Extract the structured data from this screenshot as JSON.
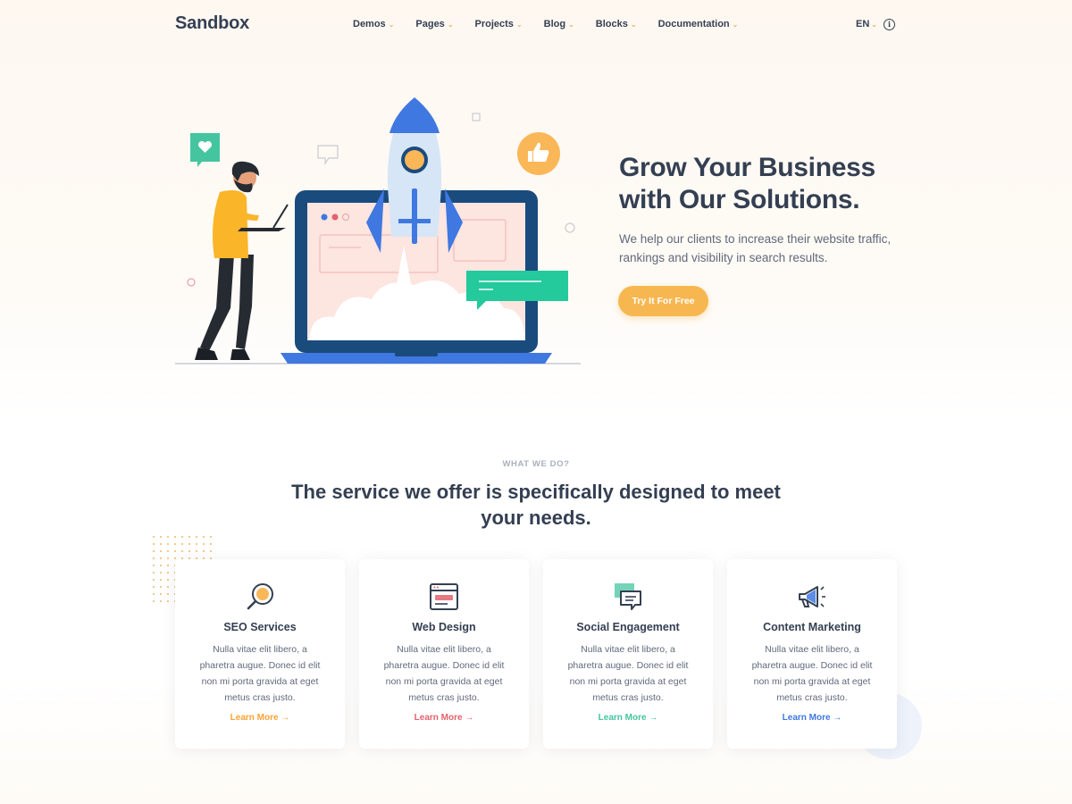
{
  "brand": {
    "logo_text": "Sandbox"
  },
  "nav": {
    "items": [
      {
        "label": "Demos"
      },
      {
        "label": "Pages"
      },
      {
        "label": "Projects"
      },
      {
        "label": "Blog"
      },
      {
        "label": "Blocks"
      },
      {
        "label": "Documentation"
      }
    ],
    "language": "EN"
  },
  "hero": {
    "title": "Grow Your Business with Our Solutions.",
    "text": "We help our clients to increase their website traffic, rankings and visibility in search results.",
    "button_label": "Try It For Free"
  },
  "services": {
    "kicker": "WHAT WE DO?",
    "title": "The service we offer is specifically designed to meet your needs.",
    "cards": [
      {
        "title": "SEO Services",
        "text": "Nulla vitae elit libero, a pharetra augue. Donec id elit non mi porta gravida at eget metus cras justo.",
        "link": "Learn More →",
        "accent": "#f7a336",
        "icon": "search-icon"
      },
      {
        "title": "Web Design",
        "text": "Nulla vitae elit libero, a pharetra augue. Donec id elit non mi porta gravida at eget metus cras justo.",
        "link": "Learn More →",
        "accent": "#e2626b",
        "icon": "browser-window-icon"
      },
      {
        "title": "Social Engagement",
        "text": "Nulla vitae elit libero, a pharetra augue. Donec id elit non mi porta gravida at eget metus cras justo.",
        "link": "Learn More →",
        "accent": "#45c4a0",
        "icon": "chat-bubbles-icon"
      },
      {
        "title": "Content Marketing",
        "text": "Nulla vitae elit libero, a pharetra augue. Donec id elit non mi porta gravida at eget metus cras justo.",
        "link": "Learn More →",
        "accent": "#3f78e0",
        "icon": "megaphone-icon"
      }
    ]
  },
  "colors": {
    "accent": "#f7b750",
    "text": "#343f52",
    "muted": "#60697b"
  }
}
